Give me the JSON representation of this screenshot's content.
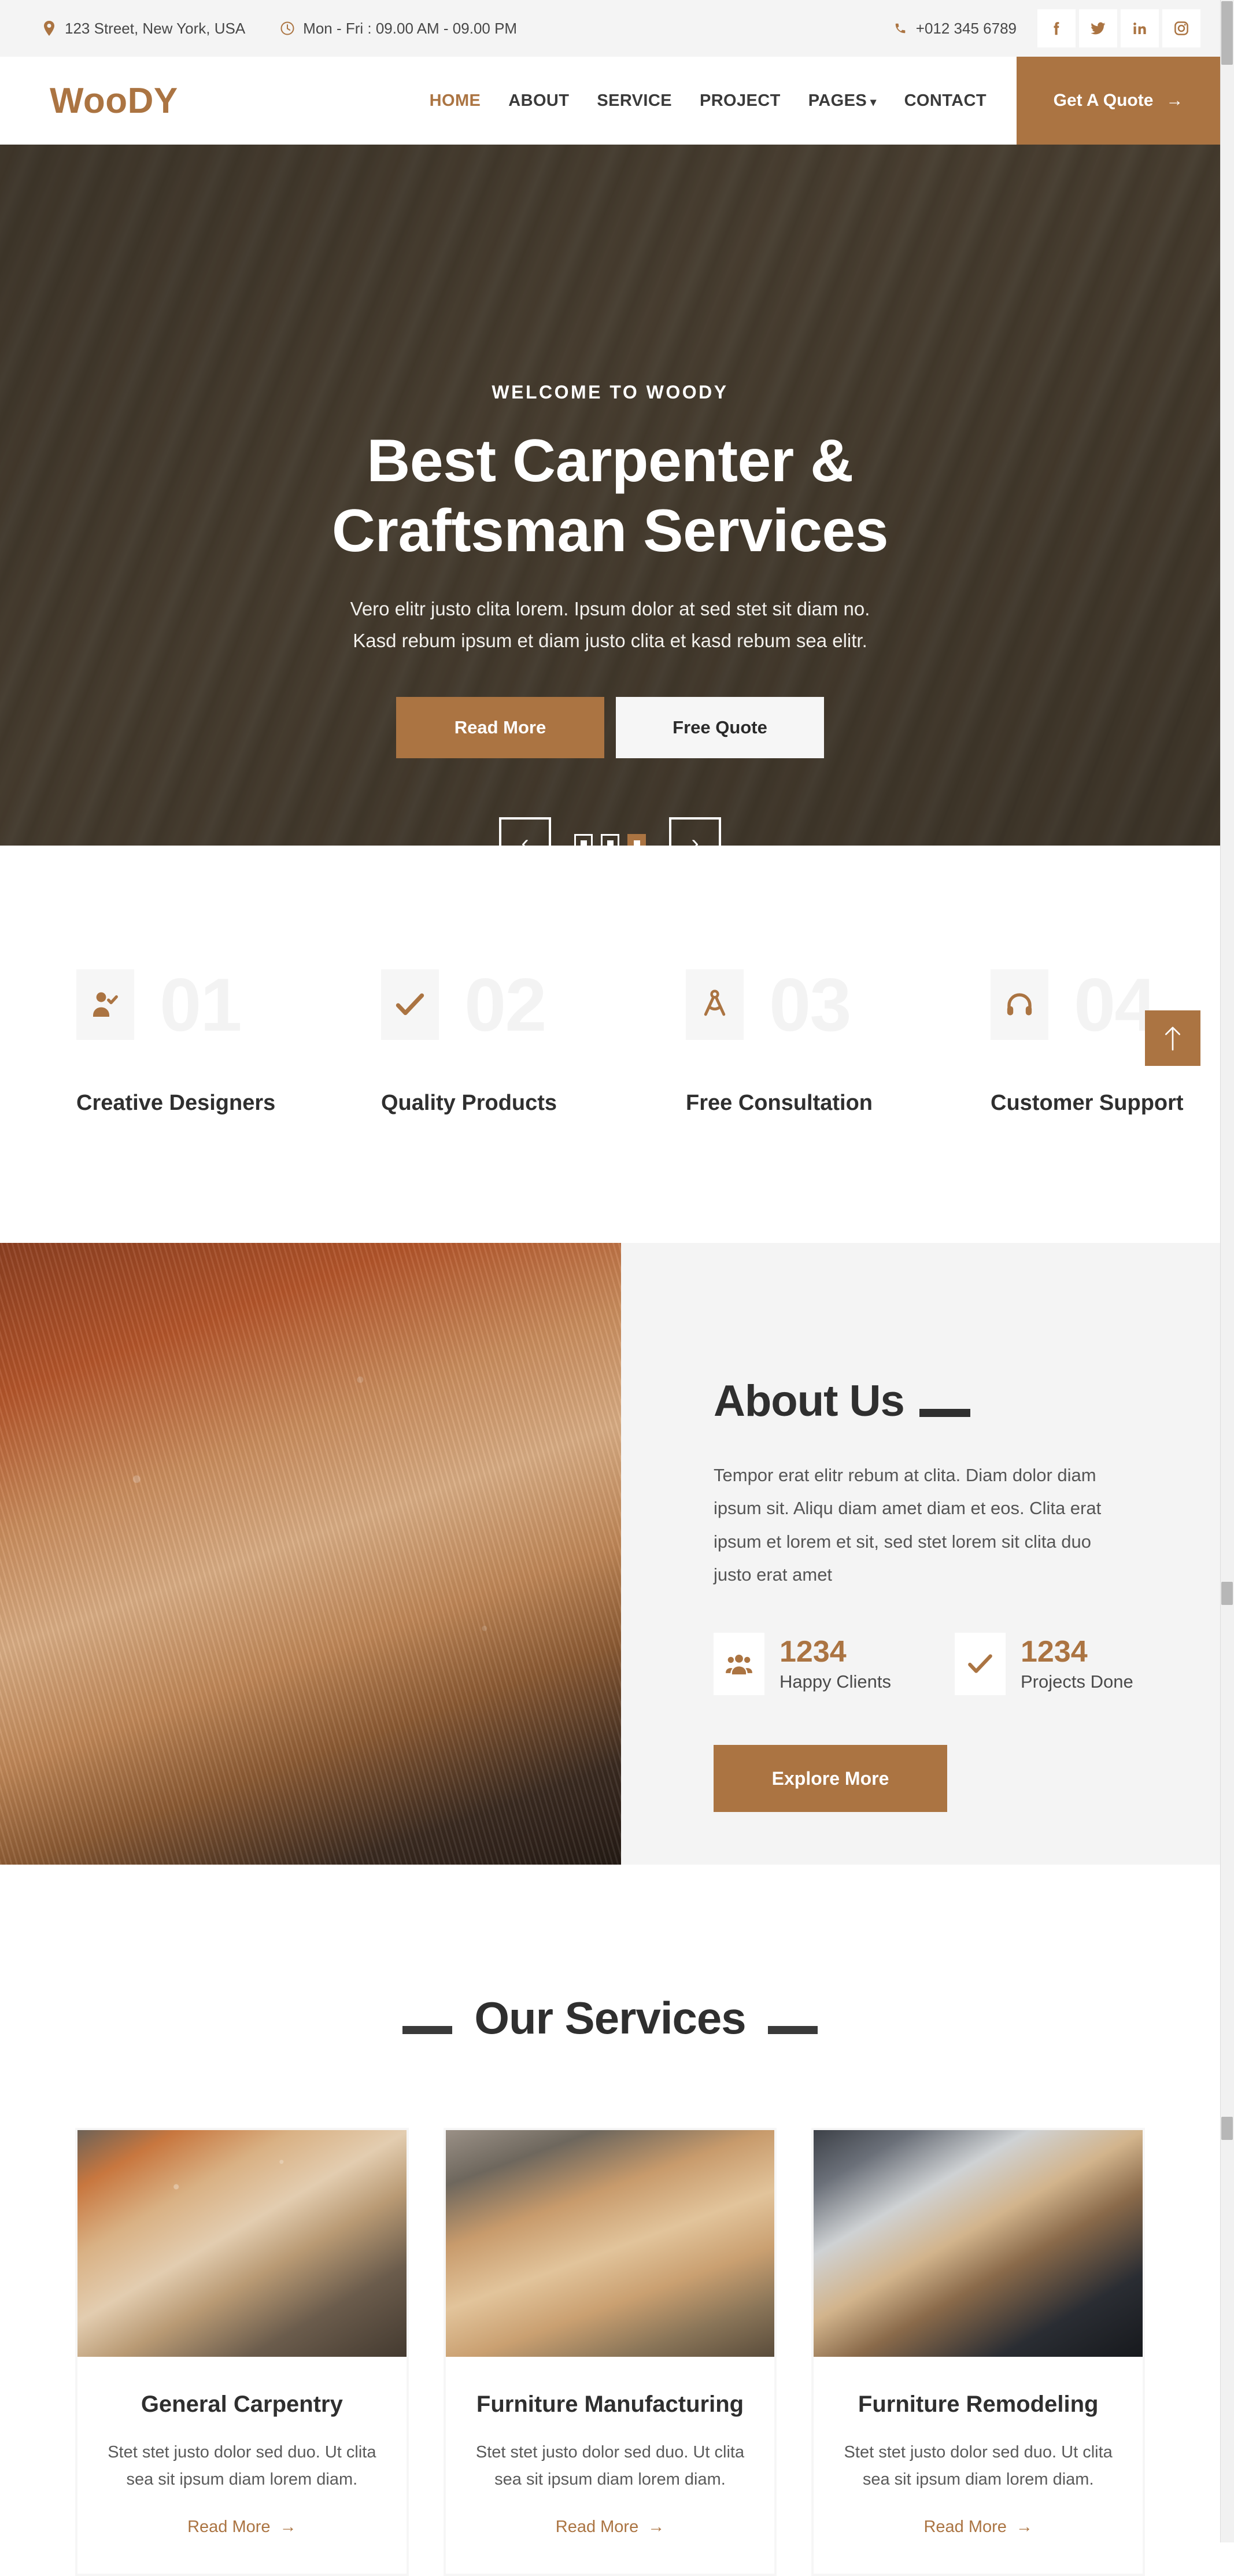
{
  "topbar": {
    "address": "123 Street, New York, USA",
    "hours": "Mon - Fri : 09.00 AM - 09.00 PM",
    "phone": "+012 345 6789",
    "socials": [
      "facebook-icon",
      "twitter-icon",
      "linkedin-icon",
      "instagram-icon"
    ]
  },
  "nav": {
    "brand": "WooDY",
    "links": [
      {
        "label": "HOME",
        "active": true
      },
      {
        "label": "ABOUT",
        "active": false
      },
      {
        "label": "SERVICE",
        "active": false
      },
      {
        "label": "PROJECT",
        "active": false
      },
      {
        "label": "PAGES",
        "active": false,
        "caret": "▾"
      },
      {
        "label": "CONTACT",
        "active": false
      }
    ],
    "quote_label": "Get A Quote",
    "quote_arrow": "→"
  },
  "hero": {
    "kicker": "WELCOME TO WOODY",
    "title_line1": "Best Carpenter &",
    "title_line2": "Craftsman Services",
    "sub_line1": "Vero elitr justo clita lorem. Ipsum dolor at sed stet sit diam no.",
    "sub_line2": "Kasd rebum ipsum et diam justo clita et kasd rebum sea elitr.",
    "btn_primary": "Read More",
    "btn_secondary": "Free Quote",
    "prev": "‹",
    "next": "›",
    "dots": [
      {
        "active": false
      },
      {
        "active": false
      },
      {
        "active": true
      }
    ]
  },
  "features": [
    {
      "number": "01",
      "label": "Creative Designers",
      "icon": "user-check-icon"
    },
    {
      "number": "02",
      "label": "Quality Products",
      "icon": "check-icon"
    },
    {
      "number": "03",
      "label": "Free Consultation",
      "icon": "compass-draft-icon"
    },
    {
      "number": "04",
      "label": "Customer Support",
      "icon": "headphones-icon"
    }
  ],
  "about": {
    "title": "About Us",
    "text": "Tempor erat elitr rebum at clita. Diam dolor diam ipsum sit. Aliqu diam amet diam et eos. Clita erat ipsum et lorem et sit, sed stet lorem sit clita duo justo erat amet",
    "stats": [
      {
        "number": "1234",
        "label": "Happy Clients",
        "icon": "people-icon"
      },
      {
        "number": "1234",
        "label": "Projects Done",
        "icon": "check-icon"
      }
    ],
    "button": "Explore More"
  },
  "services": {
    "title": "Our Services",
    "cards": [
      {
        "title": "General Carpentry",
        "text": "Stet stet justo dolor sed duo. Ut clita sea sit ipsum diam lorem diam.",
        "link": "Read More",
        "arrow": "→",
        "image": "wood-lathe-photo"
      },
      {
        "title": "Furniture Manufacturing",
        "text": "Stet stet justo dolor sed duo. Ut clita sea sit ipsum diam lorem diam.",
        "link": "Read More",
        "arrow": "→",
        "image": "workbench-tools-photo"
      },
      {
        "title": "Furniture Remodeling",
        "text": "Stet stet justo dolor sed duo. Ut clita sea sit ipsum diam lorem diam.",
        "link": "Read More",
        "arrow": "→",
        "image": "table-saw-photo"
      }
    ]
  },
  "scroll_top": {
    "arrow": "↑"
  },
  "colors": {
    "accent": "#ab7442",
    "dark": "#2f2f2f",
    "light_gray": "#f4f4f4",
    "muted": "#f3f3f3"
  }
}
